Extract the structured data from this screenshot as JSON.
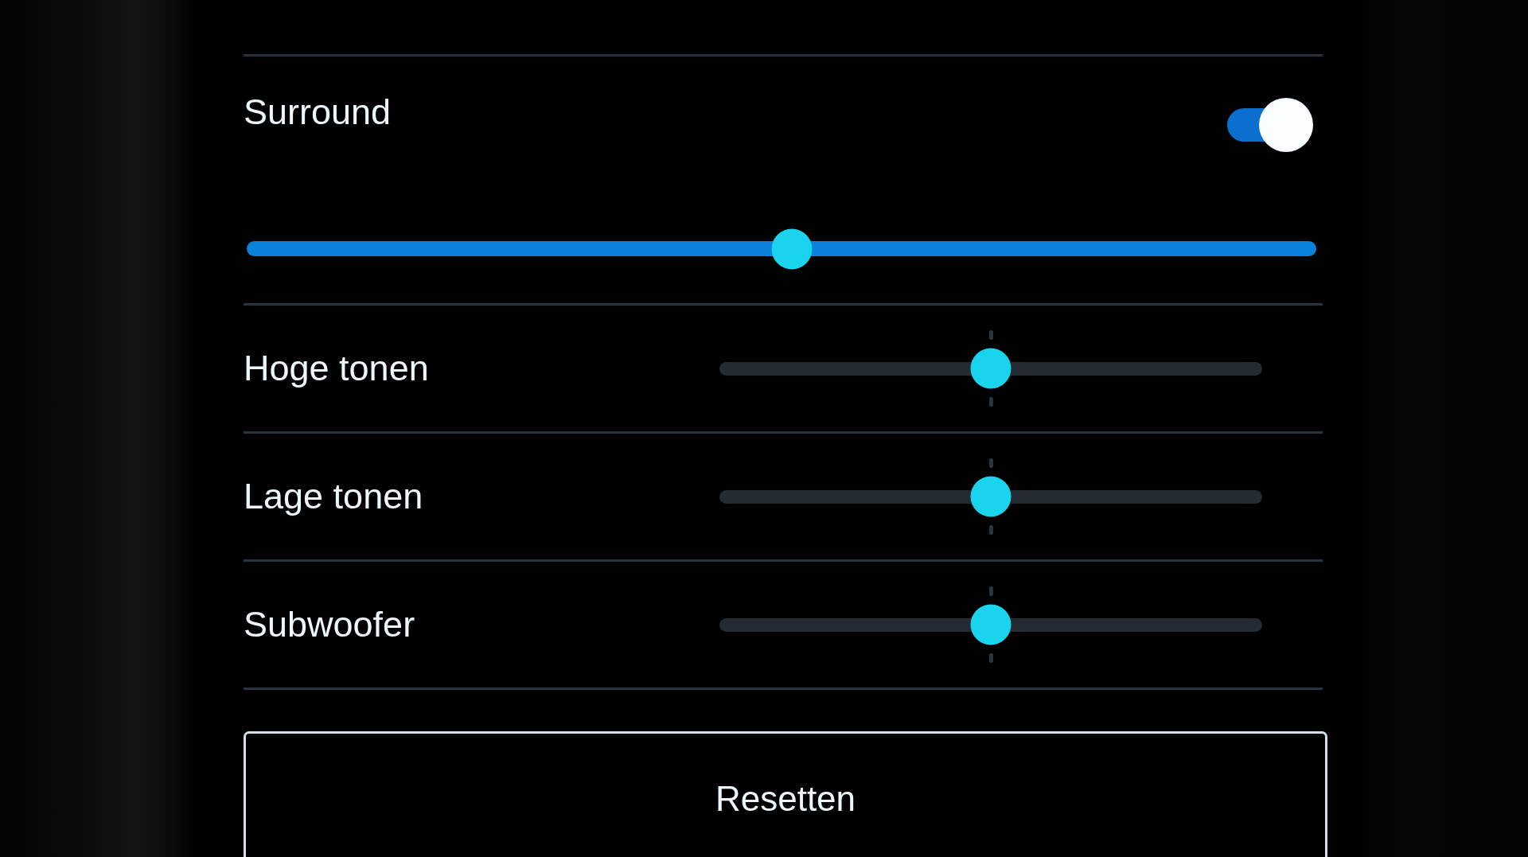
{
  "surround": {
    "label": "Surround",
    "on": true,
    "level": 0.51
  },
  "tone_controls": [
    {
      "label": "Hoge tonen",
      "level": 0.5
    },
    {
      "label": "Lage tonen",
      "level": 0.5
    },
    {
      "label": "Subwoofer",
      "level": 0.5
    }
  ],
  "reset_button": {
    "label": "Resetten"
  }
}
